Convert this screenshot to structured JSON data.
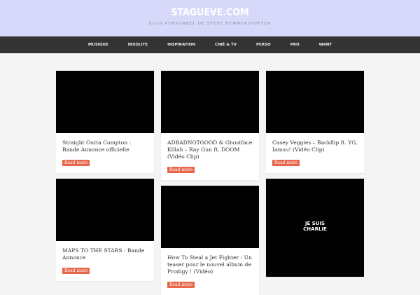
{
  "site": {
    "title": "STAGUEVE.COM",
    "tagline": "BLOG PERSONNEL DE STEVE HEMMERSTOFFER"
  },
  "nav": [
    "MUSIQUE",
    "INSOLITE",
    "INSPIRATION",
    "CINÉ & TV",
    "PERSO",
    "PRO",
    "WANT"
  ],
  "read_more": "Read more",
  "posts": [
    {
      "title": "Straight Outta Compton : Bande Annonce officielle"
    },
    {
      "title": "ADBADNOTGOOD & Ghostface Killah – Ray Gun ft. DOOM (Vidéo Clip)"
    },
    {
      "title": "Casey Veggies – Backflip ft. YG, Iamsu! (Vidéo Clip)"
    },
    {
      "title": "MAPS TO THE STARS : Bande Annonce"
    },
    {
      "title": "How To Steal a Jet Fighter : Un teaser pour le nouvel album de Prodigy ! (Vidéo)"
    },
    {
      "title": "",
      "image_text": [
        "JE SUIS",
        "CHARLIE"
      ]
    }
  ]
}
